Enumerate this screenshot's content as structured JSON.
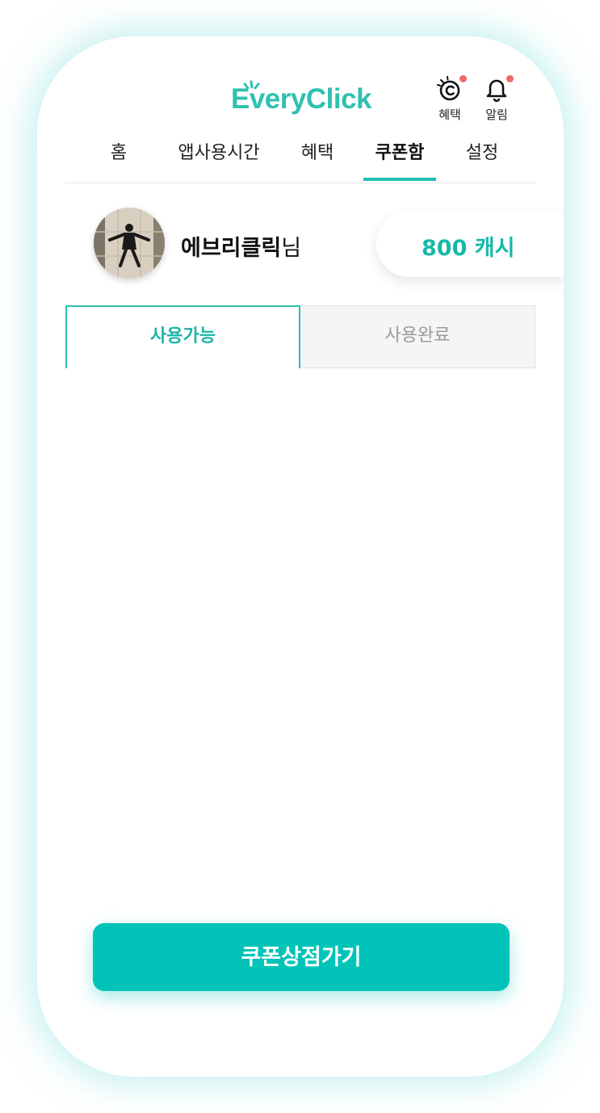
{
  "app": {
    "logo_text": "EveryClick",
    "brand_color": "#2fc0b0",
    "accent_color": "#02c3b7"
  },
  "header": {
    "benefit_label": "혜택",
    "benefit_icon": "coupon-c-icon",
    "notification_label": "알림",
    "notification_icon": "bell-icon",
    "badge_color": "#f06868"
  },
  "nav": {
    "tabs": [
      {
        "label": "홈",
        "active": false
      },
      {
        "label": "앱사용시간",
        "active": false
      },
      {
        "label": "혜택",
        "active": false
      },
      {
        "label": "쿠폰함",
        "active": true
      },
      {
        "label": "설정",
        "active": false
      }
    ]
  },
  "profile": {
    "name": "에브리클릭",
    "suffix": "님",
    "cash": "800 캐시"
  },
  "coupon_tabs": {
    "available": "사용가능",
    "used": "사용완료",
    "selected": "사용가능"
  },
  "cta": {
    "label": "쿠폰상점가기"
  }
}
